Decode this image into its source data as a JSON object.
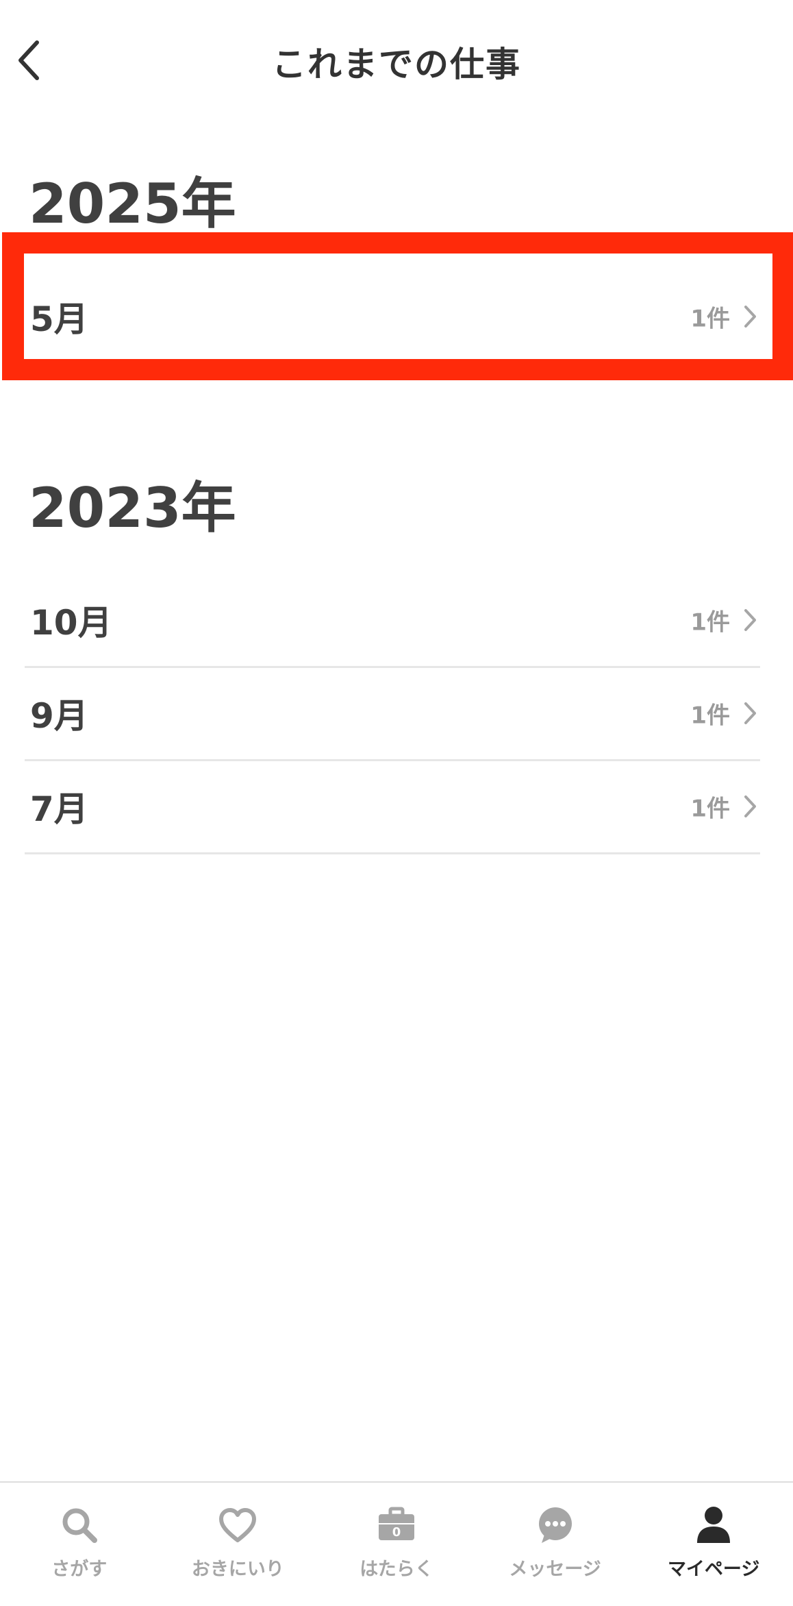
{
  "header": {
    "title": "これまでの仕事"
  },
  "sections": [
    {
      "year": "2025年",
      "rows": [
        {
          "month": "5月",
          "count": "1件"
        }
      ]
    },
    {
      "year": "2023年",
      "rows": [
        {
          "month": "10月",
          "count": "1件"
        },
        {
          "month": "9月",
          "count": "1件"
        },
        {
          "month": "7月",
          "count": "1件"
        }
      ]
    }
  ],
  "tabbar": {
    "tabs": [
      {
        "label": "さがす",
        "icon": "search-icon",
        "active": false
      },
      {
        "label": "おきにいり",
        "icon": "heart-icon",
        "active": false
      },
      {
        "label": "はたらく",
        "icon": "briefcase-icon",
        "badge": "0",
        "active": false
      },
      {
        "label": "メッセージ",
        "icon": "chat-bubble-icon",
        "active": false
      },
      {
        "label": "マイページ",
        "icon": "person-icon",
        "active": true
      }
    ]
  },
  "colors": {
    "highlight": "#ff2a0a",
    "text_primary": "#404040",
    "text_secondary": "#9a9a9a",
    "tab_inactive": "#a6a6a6",
    "tab_active": "#2a2a2a",
    "divider": "#e6e6e6"
  }
}
